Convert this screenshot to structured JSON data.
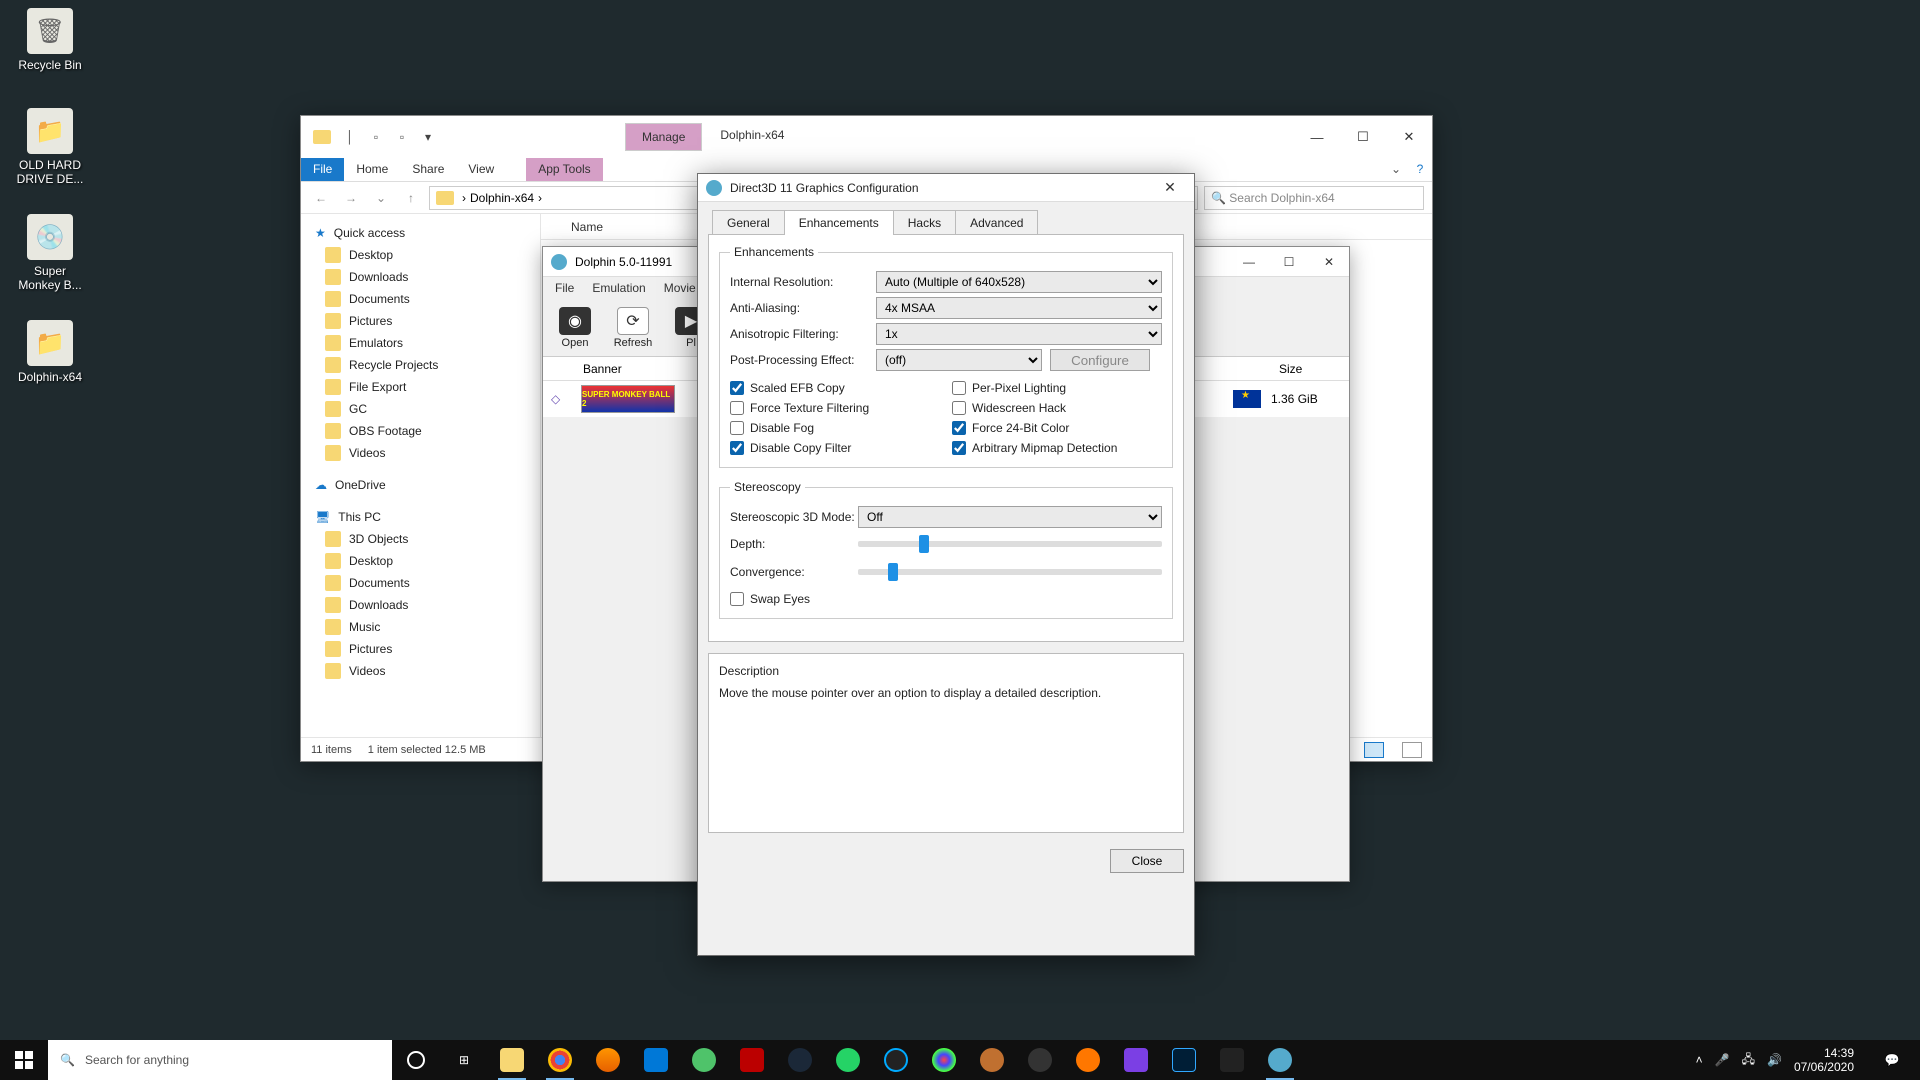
{
  "desktop_icons": [
    {
      "label": "Recycle Bin"
    },
    {
      "label": "OLD HARD DRIVE DE..."
    },
    {
      "label": "Super Monkey B..."
    },
    {
      "label": "Dolphin-x64"
    }
  ],
  "explorer": {
    "context_tab": "Manage",
    "title": "Dolphin-x64",
    "ribbon": {
      "file": "File",
      "home": "Home",
      "share": "Share",
      "view": "View",
      "apptools": "App Tools"
    },
    "path": {
      "seg1": "Dolphin-x64"
    },
    "search_placeholder": "Search Dolphin-x64",
    "sidebar": {
      "quick": "Quick access",
      "items1": [
        "Desktop",
        "Downloads",
        "Documents",
        "Pictures",
        "Emulators",
        "Recycle Projects",
        "File Export",
        "GC",
        "OBS Footage",
        "Videos"
      ],
      "onedrive": "OneDrive",
      "thispc": "This PC",
      "items2": [
        "3D Objects",
        "Desktop",
        "Documents",
        "Downloads",
        "Music",
        "Pictures",
        "Videos"
      ]
    },
    "cols": {
      "name": "Name"
    },
    "status": {
      "items": "11 items",
      "sel": "1 item selected  12.5 MB"
    }
  },
  "dolphin": {
    "title": "Dolphin 5.0-11991",
    "menu": [
      "File",
      "Emulation",
      "Movie"
    ],
    "toolbar": {
      "open": "Open",
      "refresh": "Refresh",
      "play": "Pl"
    },
    "cols": {
      "banner": "Banner",
      "size": "Size"
    },
    "row": {
      "banner_text": "SUPER MONKEY BALL 2",
      "size": "1.36 GiB"
    }
  },
  "gfx": {
    "title": "Direct3D 11 Graphics Configuration",
    "tabs": {
      "general": "General",
      "enh": "Enhancements",
      "hacks": "Hacks",
      "adv": "Advanced"
    },
    "enh_legend": "Enhancements",
    "labels": {
      "ires": "Internal Resolution:",
      "aa": "Anti-Aliasing:",
      "af": "Anisotropic Filtering:",
      "pp": "Post-Processing Effect:",
      "configure": "Configure"
    },
    "values": {
      "ires": "Auto (Multiple of 640x528)",
      "aa": "4x MSAA",
      "af": "1x",
      "pp": "(off)"
    },
    "checks": {
      "scaled_efb": "Scaled EFB Copy",
      "ppl": "Per-Pixel Lighting",
      "ftf": "Force Texture Filtering",
      "wsh": "Widescreen Hack",
      "dfog": "Disable Fog",
      "f24": "Force 24-Bit Color",
      "dcf": "Disable Copy Filter",
      "amd": "Arbitrary Mipmap Detection"
    },
    "stereo_legend": "Stereoscopy",
    "stereo": {
      "mode_lbl": "Stereoscopic 3D Mode:",
      "mode_val": "Off",
      "depth": "Depth:",
      "conv": "Convergence:",
      "swap": "Swap Eyes"
    },
    "desc": {
      "hdr": "Description",
      "body": "Move the mouse pointer over an option to display a detailed description."
    },
    "close": "Close"
  },
  "taskbar": {
    "search_placeholder": "Search for anything",
    "time": "14:39",
    "date": "07/06/2020"
  }
}
